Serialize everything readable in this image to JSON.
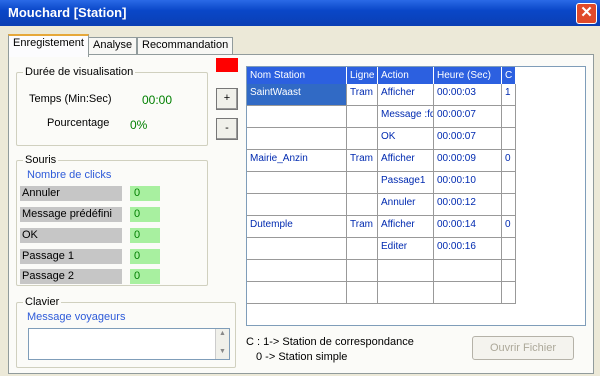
{
  "window": {
    "title": "Mouchard [Station]",
    "close_glyph": "✕"
  },
  "tabs": [
    {
      "label": "Enregistement"
    },
    {
      "label": "Analyse"
    },
    {
      "label": "Recommandation"
    }
  ],
  "duree": {
    "title": "Durée de visualisation",
    "temps_label": "Temps (Min:Sec)",
    "temps_value": "00:00",
    "pourcentage_label": "Pourcentage",
    "pourcentage_value": "0%"
  },
  "buttons": {
    "plus": "+",
    "minus": "-",
    "ouvrir": "Ouvrir Fichier"
  },
  "souris": {
    "title": "Souris",
    "subtitle": "Nombre de clicks",
    "items": [
      {
        "label": "Annuler",
        "value": "0"
      },
      {
        "label": "Message prédéfini",
        "value": "0"
      },
      {
        "label": "OK",
        "value": "0"
      },
      {
        "label": "Passage 1",
        "value": "0"
      },
      {
        "label": "Passage 2",
        "value": "0"
      }
    ]
  },
  "clavier": {
    "title": "Clavier",
    "subtitle": "Message voyageurs",
    "value": ""
  },
  "table": {
    "headers": [
      "Nom Station",
      "Ligne",
      "Action",
      "Heure (Sec)",
      "C"
    ],
    "rows": [
      [
        "SaintWaast",
        "Tram",
        "Afficher",
        "00:00:03",
        "1"
      ],
      [
        "",
        "",
        "Message :fdf",
        "00:00:07",
        ""
      ],
      [
        "",
        "",
        "OK",
        "00:00:07",
        ""
      ],
      [
        "Mairie_Anzin",
        "Tram",
        "Afficher",
        "00:00:09",
        "0"
      ],
      [
        "",
        "",
        "Passage1",
        "00:00:10",
        ""
      ],
      [
        "",
        "",
        "Annuler",
        "00:00:12",
        ""
      ],
      [
        "Dutemple",
        "Tram",
        "Afficher",
        "00:00:14",
        "0"
      ],
      [
        "",
        "",
        "Editer",
        "00:00:16",
        ""
      ],
      [
        "",
        "",
        "",
        "",
        ""
      ],
      [
        "",
        "",
        "",
        "",
        ""
      ]
    ]
  },
  "legend": {
    "line1": "C : 1-> Station de correspondance",
    "line2": "0 -> Station simple"
  },
  "colors": {
    "accent": "#2c60e0",
    "record": "#ff0000",
    "value_green": "#008000"
  }
}
